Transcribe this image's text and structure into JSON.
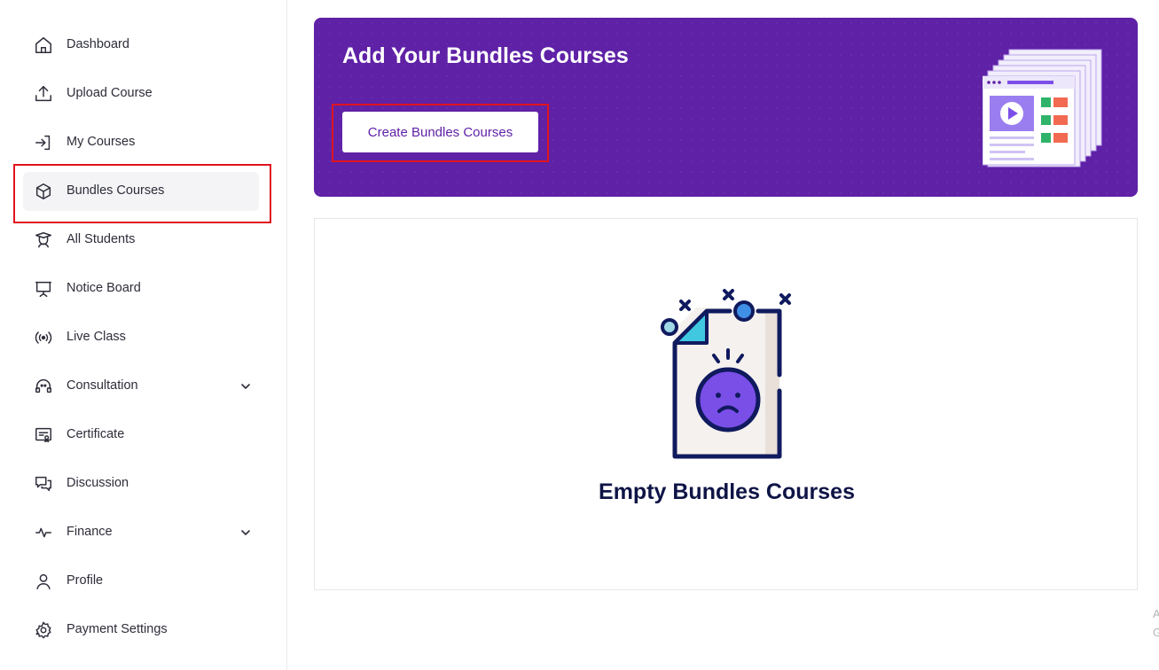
{
  "sidebar": {
    "items": [
      {
        "label": "Dashboard",
        "icon": "home-icon"
      },
      {
        "label": "Upload Course",
        "icon": "upload-icon"
      },
      {
        "label": "My Courses",
        "icon": "sign-in-icon"
      },
      {
        "label": "Bundles Courses",
        "icon": "box-icon",
        "active": true
      },
      {
        "label": "All Students",
        "icon": "student-icon"
      },
      {
        "label": "Notice Board",
        "icon": "board-icon"
      },
      {
        "label": "Live Class",
        "icon": "broadcast-icon"
      },
      {
        "label": "Consultation",
        "icon": "headset-icon",
        "expandable": true
      },
      {
        "label": "Certificate",
        "icon": "certificate-icon"
      },
      {
        "label": "Discussion",
        "icon": "chat-icon"
      },
      {
        "label": "Finance",
        "icon": "pulse-icon",
        "expandable": true
      },
      {
        "label": "Profile",
        "icon": "user-icon"
      },
      {
        "label": "Payment Settings",
        "icon": "gear-icon"
      }
    ]
  },
  "banner": {
    "title": "Add Your Bundles Courses",
    "button_label": "Create Bundles Courses"
  },
  "empty_state": {
    "message": "Empty Bundles Courses"
  },
  "edge_text": [
    "A",
    "G"
  ],
  "colors": {
    "primary": "#5f21a6",
    "highlight": "#e0141e",
    "heading": "#0f1446",
    "sad_face": "#7a4fe8"
  }
}
